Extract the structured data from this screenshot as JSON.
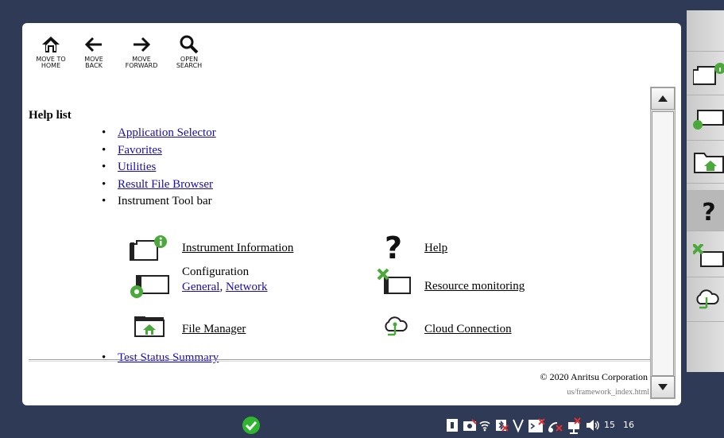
{
  "toolbar": {
    "home_label": "MOVE TO\nHOME",
    "back_label": "MOVE\nBACK",
    "forward_label": "MOVE\nFORWARD",
    "search_label": "OPEN\nSEARCH"
  },
  "help": {
    "title": "Help list",
    "links": [
      "Application Selector",
      "Favorites",
      "Utilities",
      "Result File Browser"
    ],
    "toolbar_item": "Instrument Tool bar",
    "last_link": "Test Status Summary"
  },
  "tools": {
    "instrument_information": "Instrument Information",
    "help": "Help",
    "configuration": "Configuration",
    "general": "General",
    "comma": ",",
    "network": "Network",
    "resource_monitoring": "Resource monitoring",
    "file_manager": "File Manager",
    "cloud_connection": "Cloud Connection"
  },
  "footer": {
    "copyright": "© 2020 Anritsu Corporation",
    "path": "us/framework_index.html"
  },
  "statusbar": {
    "clock_hour": "15",
    "clock_min": "16"
  },
  "colors": {
    "accent_green": "#4aa93a",
    "link": "#1a0dab",
    "background": "#2f3a57"
  }
}
